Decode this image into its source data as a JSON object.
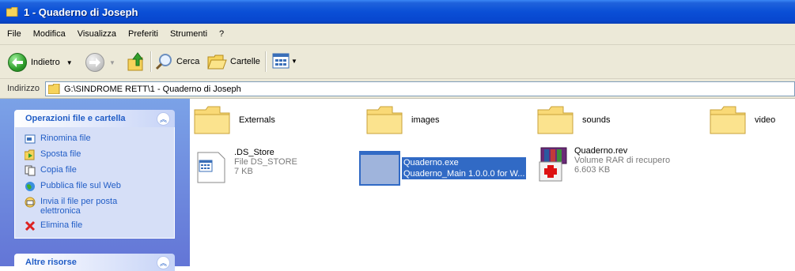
{
  "window": {
    "title": "1 - Quaderno di Joseph"
  },
  "menu": [
    "File",
    "Modifica",
    "Visualizza",
    "Preferiti",
    "Strumenti",
    "?"
  ],
  "toolbar": {
    "back_label": "Indietro",
    "search_label": "Cerca",
    "folders_label": "Cartelle"
  },
  "address": {
    "label": "Indirizzo",
    "path": "G:\\SINDROME RETT\\1 - Quaderno di Joseph"
  },
  "tasks_panel": {
    "title": "Operazioni file e cartella",
    "items": [
      {
        "label": "Rinomina file",
        "icon": "rename-icon"
      },
      {
        "label": "Sposta file",
        "icon": "move-icon"
      },
      {
        "label": "Copia file",
        "icon": "copy-icon"
      },
      {
        "label": "Pubblica file sul Web",
        "icon": "globe-icon"
      },
      {
        "label": "Invia il file per posta elettronica",
        "icon": "mail-icon"
      },
      {
        "label": "Elimina file",
        "icon": "delete-icon"
      }
    ]
  },
  "other_panel": {
    "title": "Altre risorse"
  },
  "files": [
    {
      "name": "Externals",
      "type": "folder"
    },
    {
      "name": "images",
      "type": "folder"
    },
    {
      "name": "sounds",
      "type": "folder"
    },
    {
      "name": "video",
      "type": "folder"
    },
    {
      "name": ".DS_Store",
      "line2": "File DS_STORE",
      "line3": "7 KB",
      "type": "file"
    },
    {
      "name": "Quaderno.exe",
      "line2": "Quaderno_Main 1.0.0.0 for W...",
      "type": "exe",
      "selected": true
    },
    {
      "name": "Quaderno.rev",
      "line2": "Volume RAR di recupero",
      "line3": "6.603 KB",
      "type": "rar"
    }
  ],
  "colors": {
    "titlebar": "#0a4fd6",
    "selection": "#316ac5",
    "task_link": "#215dc6"
  }
}
